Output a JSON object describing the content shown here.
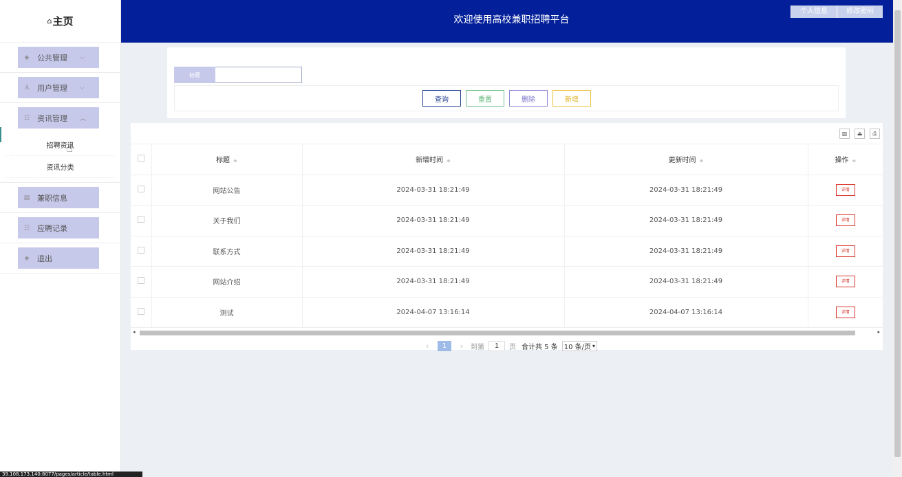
{
  "header": {
    "title": "欢迎使用高校兼职招聘平台",
    "buttons": [
      "个人信息",
      "修改密码"
    ]
  },
  "sidebar": {
    "home_glyph": "⌂",
    "home_label": "主页",
    "groups": [
      {
        "label": "公共管理",
        "icon": "layers-icon",
        "chevron": "⌵"
      },
      {
        "label": "用户管理",
        "icon": "user-icon",
        "chevron": "⌵"
      },
      {
        "label": "资讯管理",
        "icon": "list-icon",
        "chevron": "︿",
        "expanded": true,
        "children": [
          "招聘资讯",
          "资讯分类"
        ]
      },
      {
        "label": "兼职信息",
        "icon": "document-icon"
      },
      {
        "label": "应聘记录",
        "icon": "list-icon"
      },
      {
        "label": "退出",
        "icon": "layers-icon"
      }
    ]
  },
  "search": {
    "title_label": "标题",
    "title_value": "",
    "buttons": {
      "search": "查询",
      "reset": "重置",
      "delete": "删除",
      "add": "新增"
    }
  },
  "table": {
    "headers": {
      "title": "标题",
      "created": "新增时间",
      "updated": "更新时间",
      "actions": "操作"
    },
    "sort_glyph": "≑",
    "detail_label": "详情",
    "rows": [
      {
        "title": "网站公告",
        "created": "2024-03-31 18:21:49",
        "updated": "2024-03-31 18:21:49"
      },
      {
        "title": "关于我们",
        "created": "2024-03-31 18:21:49",
        "updated": "2024-03-31 18:21:49"
      },
      {
        "title": "联系方式",
        "created": "2024-03-31 18:21:49",
        "updated": "2024-03-31 18:21:49"
      },
      {
        "title": "网站介绍",
        "created": "2024-03-31 18:21:49",
        "updated": "2024-03-31 18:21:49"
      },
      {
        "title": "测试",
        "created": "2024-04-07 13:16:14",
        "updated": "2024-04-07 13:16:14"
      }
    ]
  },
  "pager": {
    "prev": "‹",
    "current": "1",
    "next": "›",
    "goto_label": "到第",
    "goto_value": "1",
    "page_unit": "页",
    "total": "合计共 5 条",
    "size": "10 条/页"
  },
  "status_url": "39.108.173.140:8077/pages/article/table.html"
}
